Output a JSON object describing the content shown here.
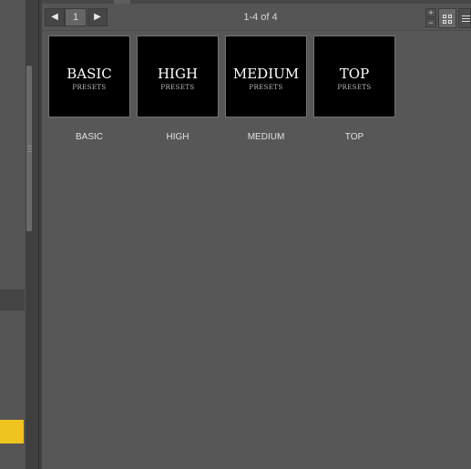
{
  "toolbar": {
    "prev_icon": "◀",
    "next_icon": "▶",
    "page_number": "1",
    "page_count": "1-4 of 4",
    "zoom_in": "+",
    "zoom_out": "−"
  },
  "tiles": [
    {
      "title": "BASIC",
      "subtitle": "PRESETS",
      "label": "BASIC"
    },
    {
      "title": "HIGH",
      "subtitle": "PRESETS",
      "label": "HIGH"
    },
    {
      "title": "MEDIUM",
      "subtitle": "PRESETS",
      "label": "MEDIUM"
    },
    {
      "title": "TOP",
      "subtitle": "PRESETS",
      "label": "TOP"
    }
  ],
  "colors": {
    "panel_bg": "#575757",
    "thumbnail_bg": "#000000",
    "highlight_tab": "#f0c41e"
  }
}
